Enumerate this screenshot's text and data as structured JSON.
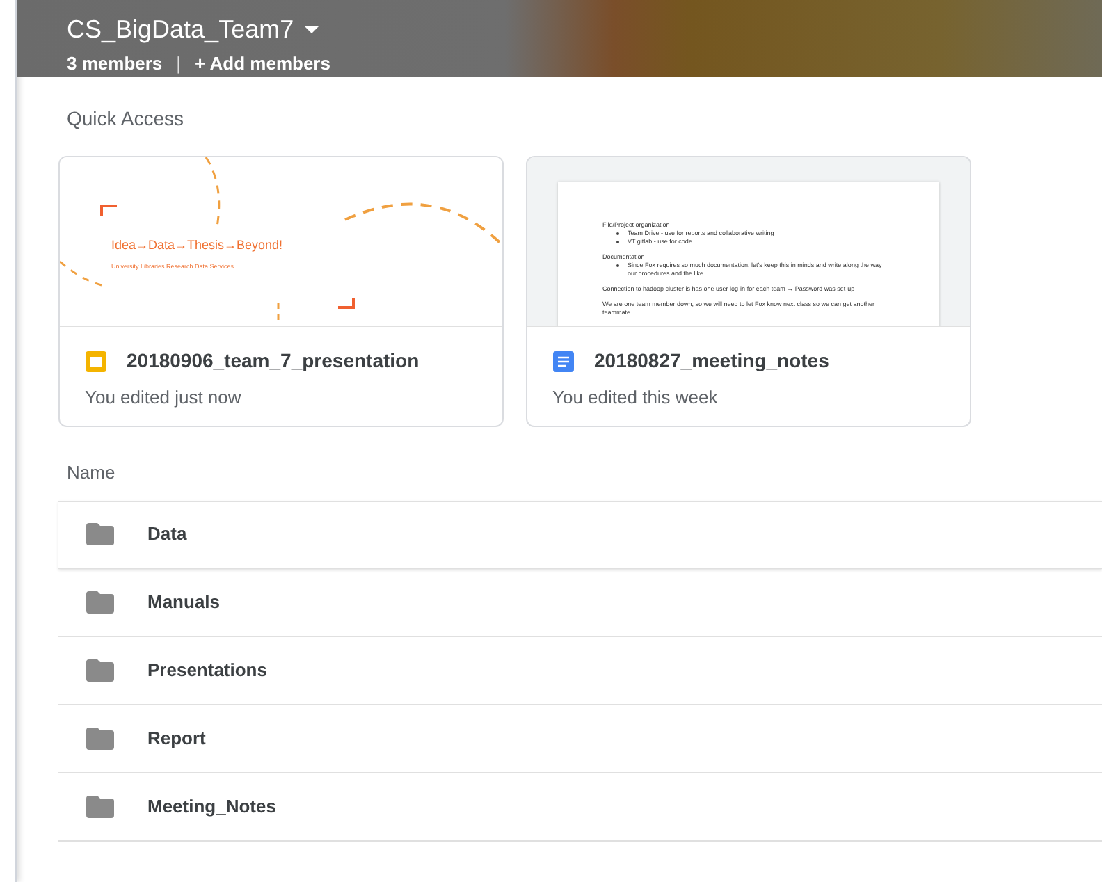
{
  "header": {
    "title": "CS_BigData_Team7",
    "members": "3 members",
    "separator": "|",
    "add_members": "+ Add members"
  },
  "quick_access": {
    "title": "Quick Access",
    "files": [
      {
        "kind": "slides",
        "name": "20180906_team_7_presentation",
        "activity": "You edited just now",
        "preview": {
          "headline": "Idea→Data→Thesis→Beyond!",
          "subtitle": "University Libraries Research Data Services"
        }
      },
      {
        "kind": "doc",
        "name": "20180827_meeting_notes",
        "activity": "You edited this week",
        "preview": {
          "lines": [
            {
              "kind": "text",
              "text": "File/Project organization"
            },
            {
              "kind": "bullet",
              "text": "Team Drive - use for reports and collaborative writing"
            },
            {
              "kind": "bullet",
              "text": "VT gitlab - use for code"
            },
            {
              "kind": "gap"
            },
            {
              "kind": "text",
              "text": "Documentation"
            },
            {
              "kind": "bullet",
              "text": "Since Fox requires so much documentation, let's keep this in minds and write along the way our procedures and the like."
            },
            {
              "kind": "gap"
            },
            {
              "kind": "text",
              "text": "Connection to hadoop cluster is has one user log-in for each team → Password was set-up"
            },
            {
              "kind": "gap"
            },
            {
              "kind": "text",
              "text": "We are one team member down, so we will need to let Fox know next class so we can get another teammate."
            }
          ]
        }
      }
    ]
  },
  "list": {
    "column": "Name",
    "folders": [
      {
        "name": "Data",
        "selected": true
      },
      {
        "name": "Manuals",
        "selected": false
      },
      {
        "name": "Presentations",
        "selected": false
      },
      {
        "name": "Report",
        "selected": false
      },
      {
        "name": "Meeting_Notes",
        "selected": false
      }
    ]
  }
}
